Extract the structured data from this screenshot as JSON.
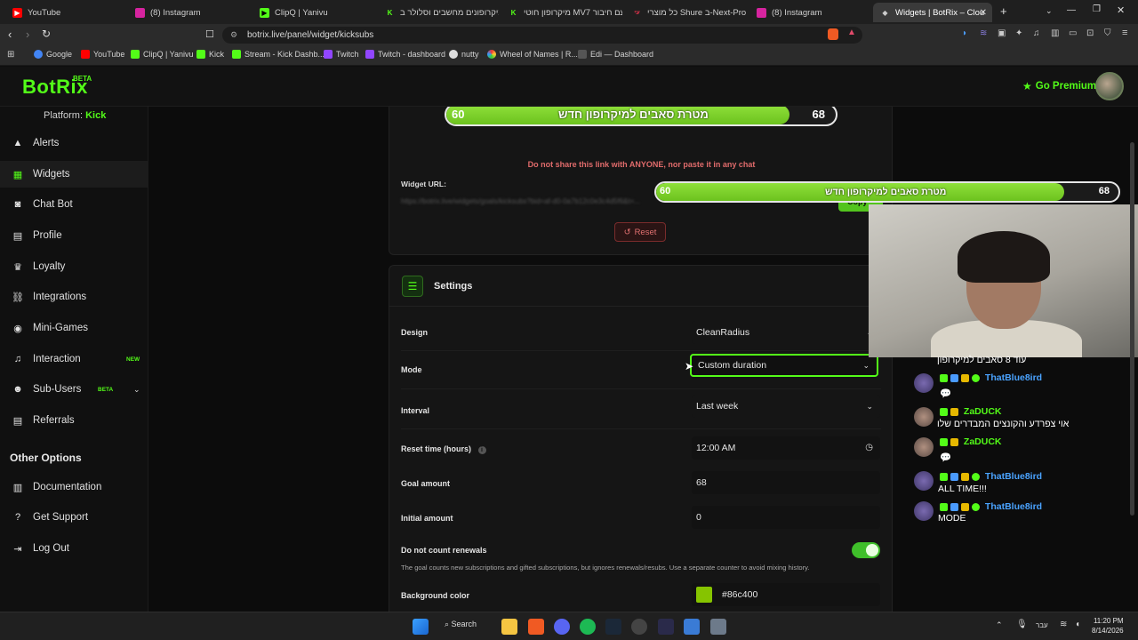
{
  "browser": {
    "tabs": [
      {
        "label": "YouTube",
        "color": "#ff0000",
        "active": false
      },
      {
        "label": "(8) Instagram",
        "color": "#d6249f",
        "active": false
      },
      {
        "label": "ClipQ | Yanivu",
        "color": "#53fc18",
        "active": false
      },
      {
        "label": "מיקרופונים מחשבים וסלולר ב",
        "color": "#53fc18",
        "active": false
      },
      {
        "label": "מיקרופון חוטי MV7 עם חיבור",
        "color": "#e0324b",
        "active": false
      },
      {
        "label": "כל מוצרי Shure ב-Next-Pro",
        "color": "#c43636",
        "active": false
      },
      {
        "label": "(8) Instagram",
        "color": "#d6249f",
        "active": false
      },
      {
        "label": "Widgets | BotRix – Cloud",
        "color": "#cccccc",
        "active": true
      }
    ],
    "url": "botrix.live/panel/widget/kicksubs",
    "bookmarks": [
      "Google",
      "YouTube",
      "ClipQ | Yanivu",
      "Kick",
      "Stream - Kick Dashb...",
      "Twitch",
      "Twitch - dashboard",
      "nutty",
      "Wheel of Names | R...",
      "Edi — Dashboard"
    ]
  },
  "header": {
    "logo": "BotRix",
    "beta": "BETA",
    "premium_label": "Go Premium"
  },
  "sidebar": {
    "platform_label": "Platform:",
    "platform_value": "Kick",
    "items": [
      {
        "label": "Alerts",
        "icon": "warning-icon"
      },
      {
        "label": "Widgets",
        "icon": "grid-icon"
      },
      {
        "label": "Chat Bot",
        "icon": "robot-icon"
      },
      {
        "label": "Profile",
        "icon": "profile-icon"
      },
      {
        "label": "Loyalty",
        "icon": "trophy-icon"
      },
      {
        "label": "Integrations",
        "icon": "integrations-icon"
      },
      {
        "label": "Mini-Games",
        "icon": "gamepad-icon"
      },
      {
        "label": "Interaction",
        "icon": "music-icon",
        "tag": "NEW"
      },
      {
        "label": "Sub-Users",
        "icon": "users-icon",
        "tag": "BETA"
      },
      {
        "label": "Referrals",
        "icon": "referrals-icon"
      }
    ],
    "other_title": "Other Options",
    "other_items": [
      {
        "label": "Documentation",
        "icon": "book-icon"
      },
      {
        "label": "Get Support",
        "icon": "question-icon"
      },
      {
        "label": "Log Out",
        "icon": "logout-icon"
      }
    ]
  },
  "preview": {
    "goal_title": "מטרת סאבים למיקרופון חדש",
    "current": "60",
    "total": "68",
    "progress_fraction": 0.882,
    "warning": "Do not share this link with ANYONE, nor paste it in any chat",
    "widget_url_label": "Widget URL:",
    "widget_url_value": "https://botrix.live/widgets/goals/kicksubs?bid=af-d0-0a7b12c0e3c4d5f6&t=...",
    "copy_label": "Copy",
    "reset_label": "Reset"
  },
  "settings": {
    "title": "Settings",
    "design_label": "Design",
    "design_value": "CleanRadius",
    "mode_label": "Mode",
    "mode_value": "Custom duration",
    "interval_label": "Interval",
    "interval_value": "Last week",
    "reset_time_label": "Reset time (hours)",
    "reset_time_value": "12:00 AM",
    "goal_amount_label": "Goal amount",
    "goal_amount_value": "68",
    "initial_amount_label": "Initial amount",
    "initial_amount_value": "0",
    "renewals_label": "Do not count renewals",
    "renewals_enabled": true,
    "renewals_hint": "The goal counts new subscriptions and gifted subscriptions, but ignores renewals/resubs. Use a separate counter to avoid mixing history.",
    "bg_color_label": "Background color",
    "bg_color_value": "#86c400"
  },
  "chat": {
    "top_line": "עוד 8 סאבים למיקרופון",
    "messages": [
      {
        "name": "ThatBlue8ird",
        "name_color": "#4aa3ff",
        "text": "💬"
      },
      {
        "name": "ZaDUCK",
        "name_color": "#53fc18",
        "text": "אוי צפרדע והקונצים המבדרים שלו"
      },
      {
        "name": "ZaDUCK",
        "name_color": "#53fc18",
        "text": "💬"
      },
      {
        "name": "ThatBlue8ird",
        "name_color": "#4aa3ff",
        "text": "ALL TIME!!!"
      },
      {
        "name": "ThatBlue8ird",
        "name_color": "#4aa3ff",
        "text": "MODE"
      }
    ]
  },
  "taskbar": {
    "search_label": "Search",
    "lang": "עבר",
    "time": "11:20 PM",
    "date": "8/14/2026"
  }
}
